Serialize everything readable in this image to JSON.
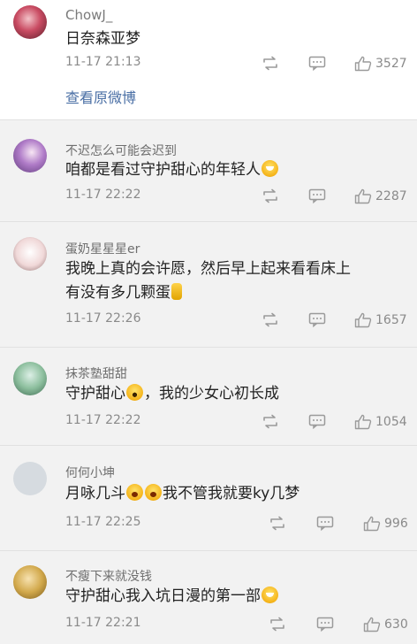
{
  "top_comment": {
    "username": "ChowJ_",
    "text": "日奈森亚梦",
    "time": "11-17 21:13",
    "likes": "3527",
    "view_original_link": "查看原微博"
  },
  "comments": [
    {
      "username": "不迟怎么可能会迟到",
      "text": "咱都是看过守护甜心的年轻人",
      "time": "11-17 22:22",
      "likes": "2287"
    },
    {
      "username": "蛋奶星星星er",
      "text_line1": "我晚上真的会许愿，然后早上起来看看床上",
      "text_line2": "有没有多几颗蛋",
      "time": "11-17 22:26",
      "likes": "1657"
    },
    {
      "username": "抹茶塾甜甜",
      "text_before": "守护甜心",
      "text_after": "，我的少女心初长成",
      "time": "11-17 22:22",
      "likes": "1054"
    },
    {
      "username": "何何小坤",
      "text_before": "月咏几斗",
      "text_after": "我不管我就要ky几梦",
      "time": "11-17 22:25",
      "likes": "996"
    },
    {
      "username": "不瘦下来就没钱",
      "text": "守护甜心我入坑日漫的第一部",
      "time": "11-17 22:21",
      "likes": "630"
    }
  ],
  "icons": {
    "repost": "repost-icon",
    "reply": "comment-icon",
    "like": "thumbs-up-icon"
  },
  "colors": {
    "link": "#4a6fa5",
    "background": "#f2f2f2",
    "card": "#ffffff"
  }
}
